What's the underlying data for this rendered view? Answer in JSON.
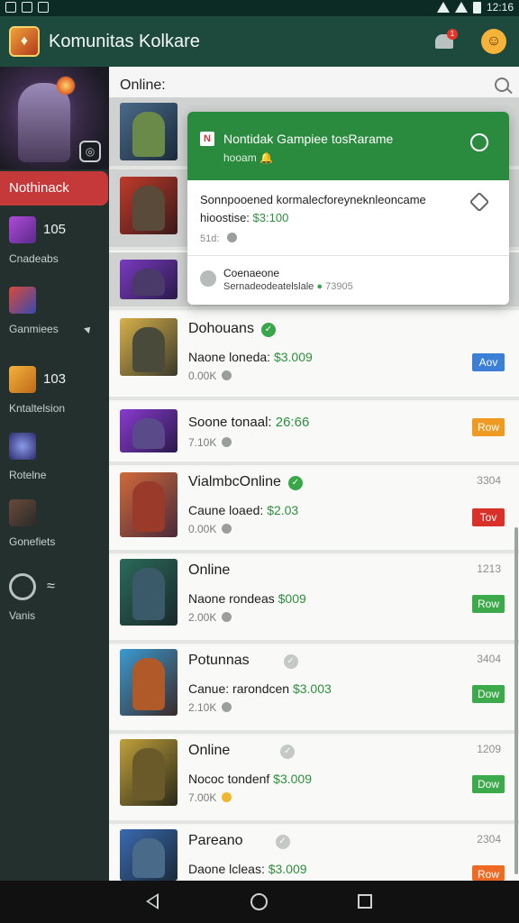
{
  "status_bar": {
    "time": "12:16"
  },
  "app_bar": {
    "title": "Komunitas Kolkare",
    "notification_count": "1"
  },
  "sidebar": {
    "selected_item": "Nothinack",
    "items": [
      {
        "count": "105",
        "label": "Cnadeabs"
      },
      {
        "count": "",
        "label": "Ganmiees"
      },
      {
        "count": "103",
        "label": "Kntaltelsion"
      },
      {
        "count": "",
        "label": "Rotelne"
      },
      {
        "count": "",
        "label": "Gonefiets"
      },
      {
        "count": "",
        "label": "Vanis"
      }
    ]
  },
  "list_header": {
    "title": "Online:"
  },
  "popup": {
    "title": "Nontidak Gampiee tosRarame",
    "subtitle": "hooam",
    "body_line1": "Sonnpooened kormalecforeyneknleoncame",
    "body_line2_prefix": "hioostise: ",
    "body_line2_price": "$3:100",
    "body_meta": "51d:",
    "footer_title": "Coenaeone",
    "footer_text": "Sernadeodeatelslale",
    "footer_count": "73905"
  },
  "rows": [
    {
      "title": "Dohouans",
      "check": "green",
      "line_prefix": "Naone loneda: ",
      "price": "$3.009",
      "meta": "0.00K",
      "meta_icon": "grey",
      "num": "",
      "tag": "Aov",
      "tag_color": "#3b7fd6"
    },
    {
      "title": "",
      "check": "",
      "line_prefix": "Soone tonaal: ",
      "price": "26:66",
      "meta": "7.10K",
      "meta_icon": "grey",
      "num": "",
      "tag": "Row",
      "tag_color": "#ef9a22"
    },
    {
      "title": "VialmbcOnline",
      "check": "green",
      "line_prefix": "Caune loaed: ",
      "price": "$2.03",
      "meta": "0.00K",
      "meta_icon": "grey",
      "num": "3304",
      "tag": "Tov",
      "tag_color": "#d9302a"
    },
    {
      "title": "Online",
      "check": "",
      "line_prefix": "Naone rondeas ",
      "price": "$009",
      "meta": "2.00K",
      "meta_icon": "grey",
      "num": "1213",
      "tag": "Row",
      "tag_color": "#3ca94a"
    },
    {
      "title": "Potunnas",
      "check": "grey",
      "line_prefix": "Canue: rarondcen ",
      "price": "$3.003",
      "meta": "2.10K",
      "meta_icon": "grey",
      "num": "3404",
      "tag": "Dow",
      "tag_color": "#3ca94a"
    },
    {
      "title": "Online",
      "check": "grey",
      "line_prefix": "Nococ tondenf ",
      "price": "$3.009",
      "meta": "7.00K",
      "meta_icon": "yellow",
      "num": "1209",
      "tag": "Dow",
      "tag_color": "#3ca94a"
    },
    {
      "title": "Pareano",
      "check": "grey",
      "line_prefix": "Daone lcleas: ",
      "price": "$3.009",
      "meta": "",
      "meta_icon": "",
      "num": "2304",
      "tag": "Row",
      "tag_color": "#ef6a22"
    }
  ],
  "colors": {
    "app_bar": "#1e4a3e",
    "sidebar": "#23302e",
    "selected": "#c5393a",
    "accent_green": "#2a8a3e"
  }
}
